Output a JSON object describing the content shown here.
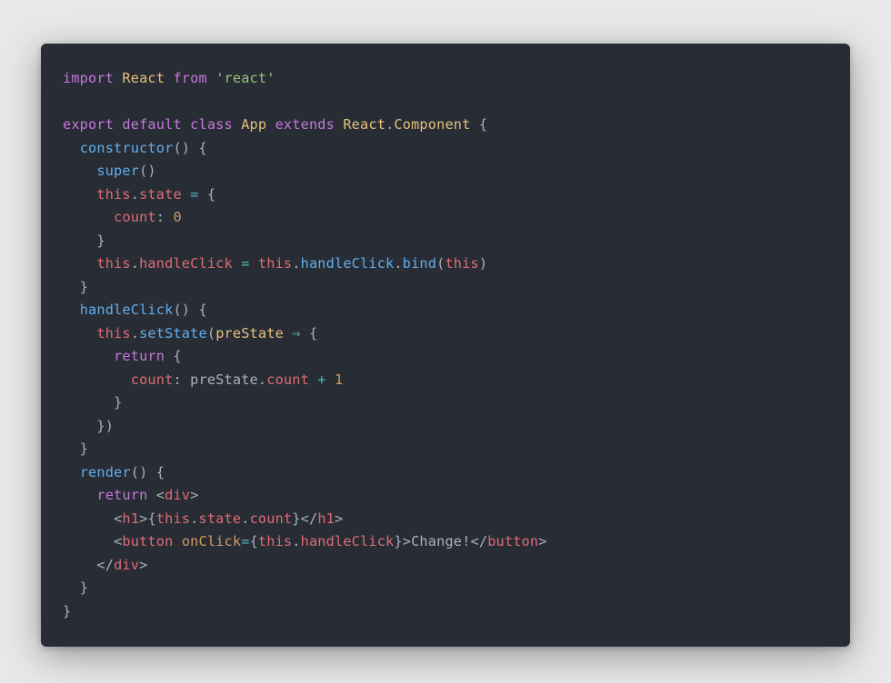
{
  "code": {
    "l1": {
      "import": "import",
      "react": "React",
      "from": "from",
      "str": "'react'"
    },
    "l3": {
      "export": "export",
      "default": "default",
      "class": "class",
      "app": "App",
      "extends": "extends",
      "reactc": "React",
      "dot": ".",
      "component": "Component",
      "brace": " {"
    },
    "l4": {
      "constructor": "constructor",
      "parens": "() {"
    },
    "l5": {
      "super": "super",
      "parens": "()"
    },
    "l6": {
      "this": "this",
      "dot": ".",
      "state": "state",
      "eq": " = ",
      "brace": "{"
    },
    "l7": {
      "count": "count",
      "colon": ": ",
      "zero": "0"
    },
    "l8": {
      "brace": "}"
    },
    "l9": {
      "this1": "this",
      "dot1": ".",
      "hc1": "handleClick",
      "eq": " = ",
      "this2": "this",
      "dot2": ".",
      "hc2": "handleClick",
      "dot3": ".",
      "bind": "bind",
      "open": "(",
      "this3": "this",
      "close": ")"
    },
    "l10": {
      "brace": "}"
    },
    "l11": {
      "hc": "handleClick",
      "parens": "() {"
    },
    "l12": {
      "this": "this",
      "dot": ".",
      "ss": "setState",
      "open": "(",
      "ps": "preState",
      "arrow": " ⇒ ",
      "brace": "{"
    },
    "l13": {
      "return": "return",
      "brace": " {"
    },
    "l14": {
      "count": "count",
      "colon": ": ",
      "ps": "preState",
      "dot": ".",
      "cnt": "count",
      "plus": " + ",
      "one": "1"
    },
    "l15": {
      "brace": "}"
    },
    "l16": {
      "brace": "})"
    },
    "l17": {
      "brace": "}"
    },
    "l18": {
      "render": "render",
      "parens": "() {"
    },
    "l19": {
      "return": "return",
      "sp": " ",
      "lt": "<",
      "div": "div",
      "gt": ">"
    },
    "l20": {
      "lt": "<",
      "h1": "h1",
      "gt": ">",
      "ob": "{",
      "this": "this",
      "d1": ".",
      "state": "state",
      "d2": ".",
      "count": "count",
      "cb": "}",
      "lt2": "</",
      "h1b": "h1",
      "gt2": ">"
    },
    "l21": {
      "lt": "<",
      "button": "button",
      "sp": " ",
      "oc": "onClick",
      "eq": "=",
      "ob": "{",
      "this": "this",
      "dot": ".",
      "hc": "handleClick",
      "cb": "}",
      "gt": ">",
      "txt": "Change!",
      "lt2": "</",
      "button2": "button",
      "gt2": ">"
    },
    "l22": {
      "lt": "</",
      "div": "div",
      "gt": ">"
    },
    "l23": {
      "brace": "}"
    },
    "l24": {
      "brace": "}"
    }
  }
}
